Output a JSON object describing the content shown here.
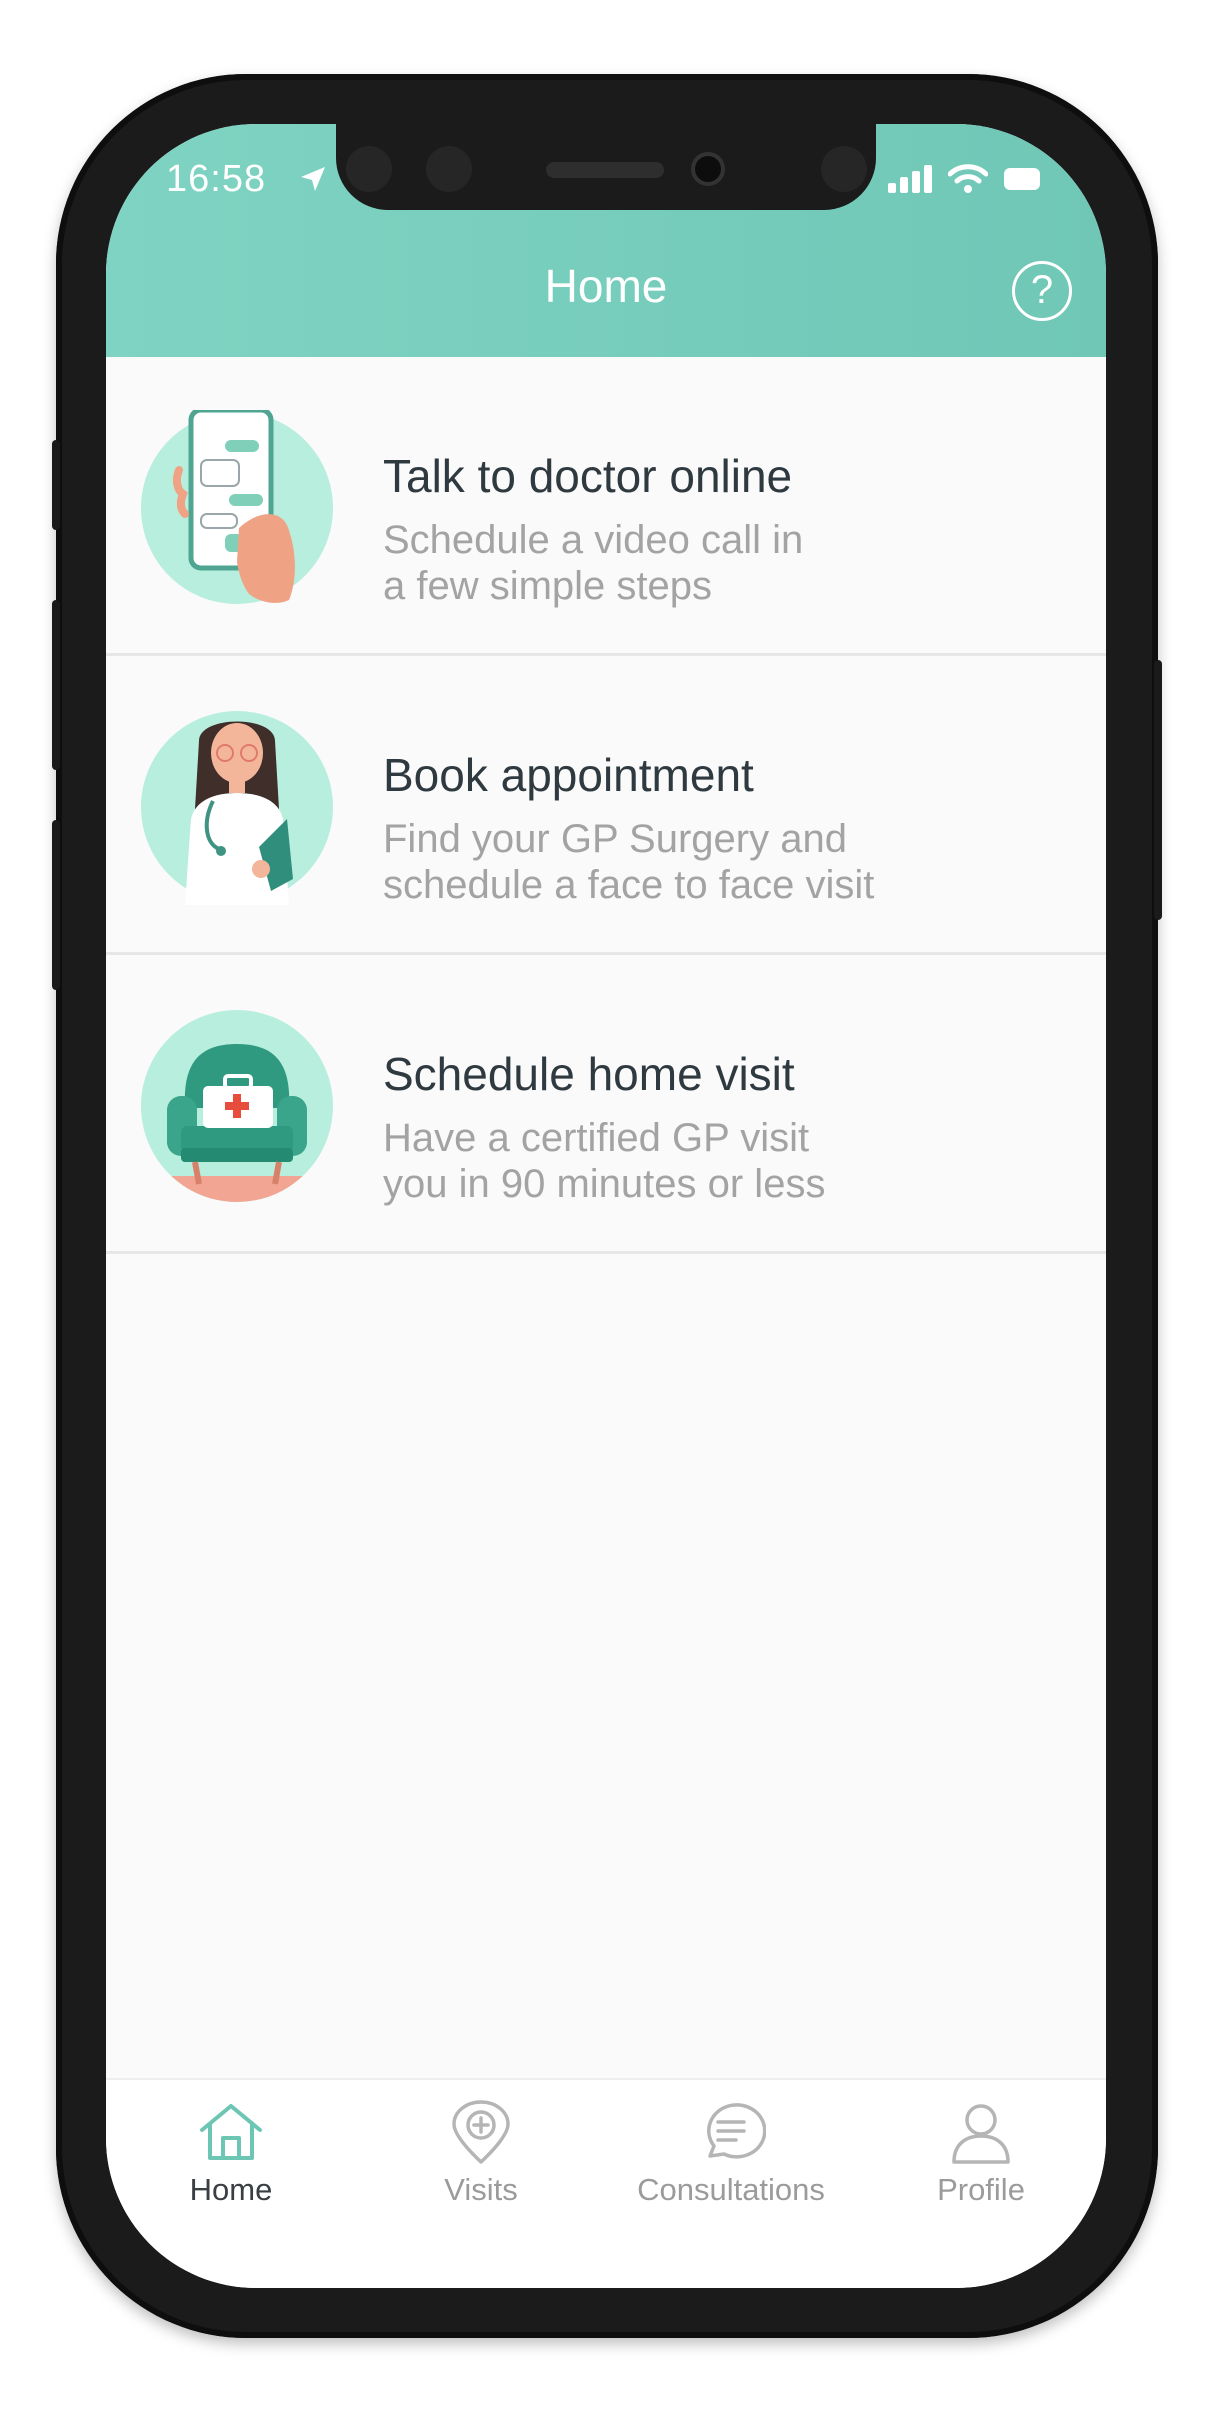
{
  "status_bar": {
    "time": "16:58"
  },
  "header": {
    "title": "Home",
    "help_label": "?"
  },
  "items": [
    {
      "title": "Talk to doctor online",
      "desc_line1": "Schedule a video call in",
      "desc_line2": "a few simple steps",
      "icon": "phone-chat-illustration"
    },
    {
      "title": "Book appointment",
      "desc_line1": "Find your GP Surgery and",
      "desc_line2": "schedule a face to face visit",
      "icon": "doctor-illustration"
    },
    {
      "title": "Schedule home visit",
      "desc_line1": "Have a certified GP visit",
      "desc_line2": "you in 90 minutes or less",
      "icon": "armchair-medkit-illustration"
    }
  ],
  "tabs": [
    {
      "label": "Home",
      "icon": "home-icon",
      "active": true
    },
    {
      "label": "Visits",
      "icon": "location-plus-icon",
      "active": false
    },
    {
      "label": "Consultations",
      "icon": "chat-bubble-icon",
      "active": false
    },
    {
      "label": "Profile",
      "icon": "user-icon",
      "active": false
    }
  ],
  "colors": {
    "accent": "#74CBBA",
    "title_text": "#2F3A40",
    "muted_text": "#A3A3A3",
    "illustration_bg": "#B8EEDD"
  }
}
